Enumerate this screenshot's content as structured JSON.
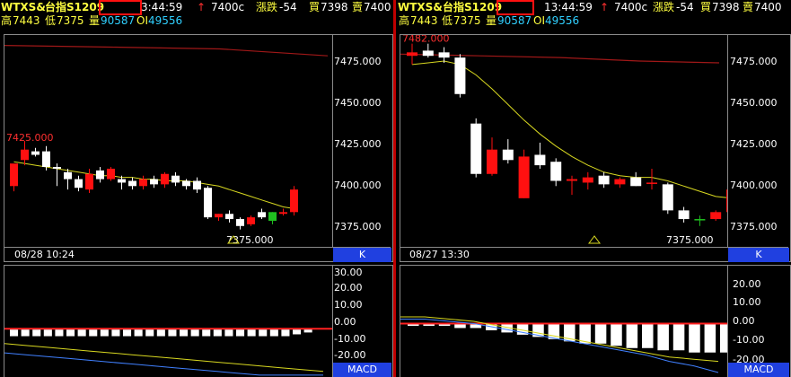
{
  "panels": [
    {
      "code": "WTXS&",
      "name": "台指S1209",
      "time": "3:44:59",
      "arrow": "↑",
      "last": "7400c",
      "change_label": "漲跌",
      "change": "-54",
      "buy_label": "買",
      "buy": "7398",
      "sell_label": "賣",
      "sell": "7400",
      "high_label": "高",
      "high": "7443",
      "low_label": "低",
      "low": "7375",
      "vol_label": "量",
      "vol": "90587",
      "oi_label": "OI",
      "oi": "49556",
      "y_ticks": [
        "7475.000",
        "7450.000",
        "7425.000",
        "7400.000",
        "7375.000"
      ],
      "high_marker": "7425.000",
      "low_marker": "7375.000",
      "date": "08/28 10:24",
      "k_button": "K",
      "macd_ticks": [
        "30.00",
        "20.00",
        "10.00",
        "0.00",
        "-10.00",
        "-20.00"
      ],
      "macd_button": "MACD"
    },
    {
      "code": "WTXS&",
      "name": "台指S1209",
      "time": "13:44:59",
      "arrow": "↑",
      "last": "7400c",
      "change_label": "漲跌",
      "change": "-54",
      "buy_label": "買",
      "buy": "7398",
      "sell_label": "賣",
      "sell": "7400",
      "high_label": "高",
      "high": "7443",
      "low_label": "低",
      "low": "7375",
      "vol_label": "量",
      "vol": "90587",
      "oi_label": "OI",
      "oi": "49556",
      "y_ticks": [
        "7475.000",
        "7450.000",
        "7425.000",
        "7400.000",
        "7375.000"
      ],
      "high_marker": "7482.000",
      "low_marker": "7375.000",
      "date": "08/27 13:30",
      "k_button": "K",
      "macd_ticks": [
        "20.00",
        "10.00",
        "0.00",
        "-10.00",
        "-20.00"
      ],
      "macd_button": "MACD"
    }
  ],
  "colors": {
    "up": "#ff1010",
    "down": "#ffffff",
    "ma_yellow": "#d8d820",
    "ma_dark_red": "#a01818",
    "macd_blue": "#4080ff",
    "accent_blue": "#2040e0"
  },
  "chart_data": [
    {
      "type": "candlestick",
      "panel": "left",
      "ylim": [
        7365,
        7487
      ],
      "y_ticks": [
        7475,
        7450,
        7425,
        7400,
        7375
      ],
      "candles": [
        {
          "o": 7400,
          "h": 7405,
          "l": 7397,
          "c": 7413
        },
        {
          "o": 7415,
          "h": 7426,
          "l": 7412,
          "c": 7421
        },
        {
          "o": 7420,
          "h": 7422,
          "l": 7417,
          "c": 7418
        },
        {
          "o": 7420,
          "h": 7423,
          "l": 7409,
          "c": 7411
        },
        {
          "o": 7411,
          "h": 7413,
          "l": 7400,
          "c": 7410
        },
        {
          "o": 7408,
          "h": 7410,
          "l": 7398,
          "c": 7404
        },
        {
          "o": 7404,
          "h": 7406,
          "l": 7397,
          "c": 7399
        },
        {
          "o": 7398,
          "h": 7410,
          "l": 7396,
          "c": 7407
        },
        {
          "o": 7409,
          "h": 7411,
          "l": 7402,
          "c": 7404
        },
        {
          "o": 7404,
          "h": 7411,
          "l": 7403,
          "c": 7410
        },
        {
          "o": 7404,
          "h": 7406,
          "l": 7398,
          "c": 7402
        },
        {
          "o": 7403,
          "h": 7405,
          "l": 7398,
          "c": 7400
        },
        {
          "o": 7400,
          "h": 7406,
          "l": 7398,
          "c": 7404
        },
        {
          "o": 7404,
          "h": 7406,
          "l": 7399,
          "c": 7401
        },
        {
          "o": 7401,
          "h": 7408,
          "l": 7399,
          "c": 7407
        },
        {
          "o": 7406,
          "h": 7408,
          "l": 7400,
          "c": 7402
        },
        {
          "o": 7403,
          "h": 7404,
          "l": 7398,
          "c": 7400
        },
        {
          "o": 7403,
          "h": 7405,
          "l": 7396,
          "c": 7398
        },
        {
          "o": 7399,
          "h": 7400,
          "l": 7381,
          "c": 7382
        },
        {
          "o": 7382,
          "h": 7384,
          "l": 7380,
          "c": 7384
        },
        {
          "o": 7384,
          "h": 7386,
          "l": 7379,
          "c": 7381
        },
        {
          "o": 7381,
          "h": 7382,
          "l": 7375,
          "c": 7377
        },
        {
          "o": 7378,
          "h": 7383,
          "l": 7377,
          "c": 7382
        },
        {
          "o": 7385,
          "h": 7387,
          "l": 7381,
          "c": 7382
        },
        {
          "o": 7380,
          "h": 7385,
          "l": 7378,
          "c": 7385,
          "doji": true
        },
        {
          "o": 7384,
          "h": 7387,
          "l": 7383,
          "c": 7385
        },
        {
          "o": 7385,
          "h": 7400,
          "l": 7383,
          "c": 7398
        }
      ],
      "ma_yellow": [
        7414,
        7413,
        7412,
        7411,
        7410,
        7409,
        7408,
        7407,
        7406,
        7406,
        7405,
        7405,
        7404,
        7404,
        7403,
        7403,
        7403,
        7402,
        7401,
        7400,
        7398,
        7396,
        7394,
        7392,
        7390,
        7388,
        7387
      ],
      "ma_darkred": [
        7481,
        7480,
        7479,
        7475
      ],
      "macd_ylim": [
        -26,
        34
      ],
      "macd_hist": [
        -4,
        -4,
        -4,
        -4,
        -4,
        -4,
        -4,
        -4,
        -4,
        -4,
        -4,
        -4,
        -4,
        -4,
        -4,
        -4,
        -4,
        -4,
        -4,
        -4,
        -4,
        -4,
        -4,
        -4,
        -4,
        -3,
        -2
      ],
      "macd_line": [
        -8,
        -9,
        -10,
        -11,
        -12,
        -13,
        -14,
        -15,
        -16,
        -17,
        -18,
        -19,
        -20,
        -21,
        -22,
        -23
      ],
      "macd_signal": [
        -13,
        -14,
        -15,
        -16,
        -17,
        -18,
        -19,
        -20,
        -21,
        -22,
        -23,
        -24,
        -25,
        -25,
        -25,
        -25
      ]
    },
    {
      "type": "candlestick",
      "panel": "right",
      "ylim": [
        7365,
        7487
      ],
      "y_ticks": [
        7475,
        7450,
        7425,
        7400,
        7375
      ],
      "candles": [
        {
          "o": 7475,
          "h": 7482,
          "l": 7470,
          "c": 7477
        },
        {
          "o": 7478,
          "h": 7482,
          "l": 7474,
          "c": 7475
        },
        {
          "o": 7477,
          "h": 7480,
          "l": 7471,
          "c": 7474
        },
        {
          "o": 7474,
          "h": 7476,
          "l": 7451,
          "c": 7453
        },
        {
          "o": 7436,
          "h": 7439,
          "l": 7405,
          "c": 7407
        },
        {
          "o": 7407,
          "h": 7428,
          "l": 7406,
          "c": 7421
        },
        {
          "o": 7421,
          "h": 7427,
          "l": 7413,
          "c": 7415
        },
        {
          "o": 7393,
          "h": 7421,
          "l": 7393,
          "c": 7417
        },
        {
          "o": 7418,
          "h": 7425,
          "l": 7410,
          "c": 7412
        },
        {
          "o": 7414,
          "h": 7416,
          "l": 7400,
          "c": 7403
        },
        {
          "o": 7403,
          "h": 7406,
          "l": 7395,
          "c": 7404
        },
        {
          "o": 7402,
          "h": 7408,
          "l": 7398,
          "c": 7405
        },
        {
          "o": 7406,
          "h": 7408,
          "l": 7399,
          "c": 7401
        },
        {
          "o": 7401,
          "h": 7405,
          "l": 7399,
          "c": 7404
        },
        {
          "o": 7405,
          "h": 7408,
          "l": 7400,
          "c": 7400
        },
        {
          "o": 7402,
          "h": 7410,
          "l": 7398,
          "c": 7402
        },
        {
          "o": 7401,
          "h": 7402,
          "l": 7384,
          "c": 7386
        },
        {
          "o": 7386,
          "h": 7388,
          "l": 7379,
          "c": 7381
        },
        {
          "o": 7381,
          "h": 7383,
          "l": 7377,
          "c": 7381,
          "doji": true
        },
        {
          "o": 7381,
          "h": 7386,
          "l": 7380,
          "c": 7385
        },
        {
          "o": 7385,
          "h": 7400,
          "l": 7380,
          "c": 7398
        }
      ],
      "ma_yellow": [
        7470,
        7471,
        7472,
        7470,
        7464,
        7456,
        7447,
        7438,
        7430,
        7423,
        7417,
        7412,
        7408,
        7406,
        7405,
        7405,
        7403,
        7400,
        7397,
        7394,
        7393
      ],
      "ma_darkred": [
        7476,
        7475,
        7474,
        7472,
        7471
      ],
      "macd_ylim": [
        -24,
        26
      ],
      "macd_hist": [
        -1,
        -1,
        -1,
        -2,
        -2,
        -3,
        -4,
        -5,
        -6,
        -7,
        -8,
        -9,
        -9,
        -10,
        -11,
        -11,
        -12,
        -12,
        -13,
        -13,
        -13
      ],
      "macd_line": [
        3,
        3,
        2,
        1,
        -1,
        -3,
        -5,
        -7,
        -9,
        -11,
        -13,
        -15,
        -16,
        -17
      ],
      "macd_signal": [
        2,
        2,
        1,
        0,
        -2,
        -4,
        -6,
        -8,
        -10,
        -12,
        -14,
        -17,
        -19,
        -22
      ]
    }
  ]
}
